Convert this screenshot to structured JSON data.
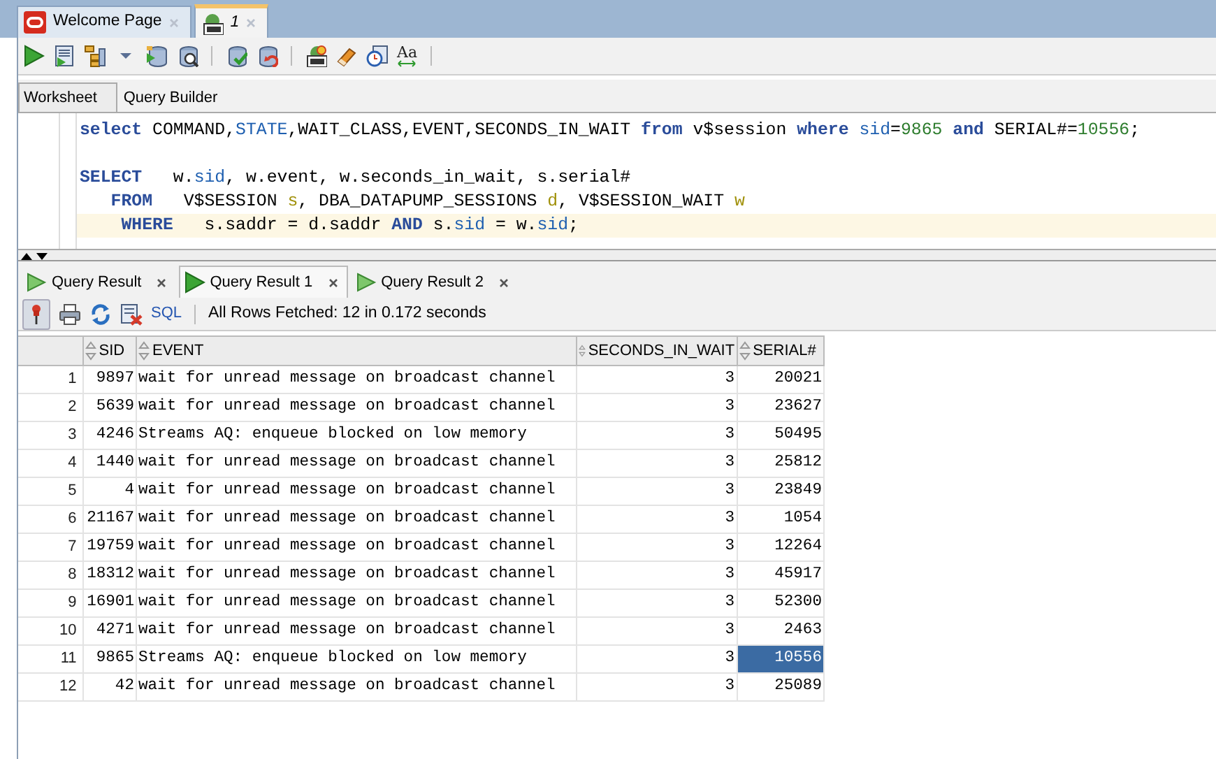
{
  "doc_tabs": [
    {
      "label": "Welcome Page",
      "kind": "welcome",
      "italic": false,
      "selected": false
    },
    {
      "label": "1",
      "kind": "sql",
      "italic": true,
      "selected": true
    }
  ],
  "toolbar": {
    "format_label": "Aa"
  },
  "editor_tabs": [
    {
      "label": "Worksheet",
      "selected": true
    },
    {
      "label": "Query Builder",
      "selected": false
    }
  ],
  "code_lines": [
    {
      "current": false,
      "tokens": [
        {
          "text": "select",
          "kind": "keyword"
        },
        {
          "text": " COMMAND,",
          "kind": "plain"
        },
        {
          "text": "STATE",
          "kind": "column"
        },
        {
          "text": ",WAIT_CLASS,EVENT,SECONDS_IN_WAIT ",
          "kind": "plain"
        },
        {
          "text": "from",
          "kind": "keyword"
        },
        {
          "text": " v$session ",
          "kind": "plain"
        },
        {
          "text": "where",
          "kind": "keyword"
        },
        {
          "text": " sid",
          "kind": "column"
        },
        {
          "text": "=",
          "kind": "plain"
        },
        {
          "text": "9865",
          "kind": "number"
        },
        {
          "text": " and",
          "kind": "keyword"
        },
        {
          "text": " SERIAL#=",
          "kind": "plain"
        },
        {
          "text": "10556",
          "kind": "number"
        },
        {
          "text": ";",
          "kind": "plain"
        }
      ]
    },
    {
      "current": false
    },
    {
      "current": false,
      "tokens": [
        {
          "text": "SELECT",
          "kind": "keyword"
        },
        {
          "text": "   w.",
          "kind": "plain"
        },
        {
          "text": "sid",
          "kind": "column"
        },
        {
          "text": ", w.event, w.seconds_in_wait, s.serial#",
          "kind": "plain"
        }
      ]
    },
    {
      "current": false,
      "tokens": [
        {
          "text": "   FROM",
          "kind": "keyword"
        },
        {
          "text": "   V$SESSION ",
          "kind": "plain"
        },
        {
          "text": "s",
          "kind": "alias"
        },
        {
          "text": ", DBA_DATAPUMP_SESSIONS ",
          "kind": "plain"
        },
        {
          "text": "d",
          "kind": "alias"
        },
        {
          "text": ", V$SESSION_WAIT ",
          "kind": "plain"
        },
        {
          "text": "w",
          "kind": "alias"
        }
      ]
    },
    {
      "current": true,
      "tokens": [
        {
          "text": "    WHERE",
          "kind": "keyword"
        },
        {
          "text": "   s.saddr = d.saddr ",
          "kind": "plain"
        },
        {
          "text": "AND",
          "kind": "keyword"
        },
        {
          "text": " s.",
          "kind": "plain"
        },
        {
          "text": "sid",
          "kind": "column"
        },
        {
          "text": " = w.",
          "kind": "plain"
        },
        {
          "text": "sid",
          "kind": "column"
        },
        {
          "text": ";",
          "kind": "plain"
        }
      ]
    }
  ],
  "result_tabs": [
    {
      "label": "Query Result",
      "selected": false
    },
    {
      "label": "Query Result 1",
      "selected": true
    },
    {
      "label": "Query Result 2",
      "selected": false
    }
  ],
  "result_toolbar": {
    "sql_link": "SQL",
    "status": "All Rows Fetched: 12 in 0.172 seconds"
  },
  "columns": [
    "SID",
    "EVENT",
    "SECONDS_IN_WAIT",
    "SERIAL#"
  ],
  "rows": [
    {
      "n": "1",
      "sid": "9897",
      "event": "wait for unread message on broadcast channel",
      "secs": "3",
      "serial": "20021",
      "selected": false
    },
    {
      "n": "2",
      "sid": "5639",
      "event": "wait for unread message on broadcast channel",
      "secs": "3",
      "serial": "23627",
      "selected": false
    },
    {
      "n": "3",
      "sid": "4246",
      "event": "Streams AQ: enqueue blocked on low memory",
      "secs": "3",
      "serial": "50495",
      "selected": false
    },
    {
      "n": "4",
      "sid": "1440",
      "event": "wait for unread message on broadcast channel",
      "secs": "3",
      "serial": "25812",
      "selected": false
    },
    {
      "n": "5",
      "sid": "4",
      "event": "wait for unread message on broadcast channel",
      "secs": "3",
      "serial": "23849",
      "selected": false
    },
    {
      "n": "6",
      "sid": "21167",
      "event": "wait for unread message on broadcast channel",
      "secs": "3",
      "serial": "1054",
      "selected": false
    },
    {
      "n": "7",
      "sid": "19759",
      "event": "wait for unread message on broadcast channel",
      "secs": "3",
      "serial": "12264",
      "selected": false
    },
    {
      "n": "8",
      "sid": "18312",
      "event": "wait for unread message on broadcast channel",
      "secs": "3",
      "serial": "45917",
      "selected": false
    },
    {
      "n": "9",
      "sid": "16901",
      "event": "wait for unread message on broadcast channel",
      "secs": "3",
      "serial": "52300",
      "selected": false
    },
    {
      "n": "10",
      "sid": "4271",
      "event": "wait for unread message on broadcast channel",
      "secs": "3",
      "serial": "2463",
      "selected": false
    },
    {
      "n": "11",
      "sid": "9865",
      "event": "Streams AQ: enqueue blocked on low memory",
      "secs": "3",
      "serial": "10556",
      "selected": true
    },
    {
      "n": "12",
      "sid": "42",
      "event": "wait for unread message on broadcast channel",
      "secs": "3",
      "serial": "25089",
      "selected": false
    }
  ]
}
